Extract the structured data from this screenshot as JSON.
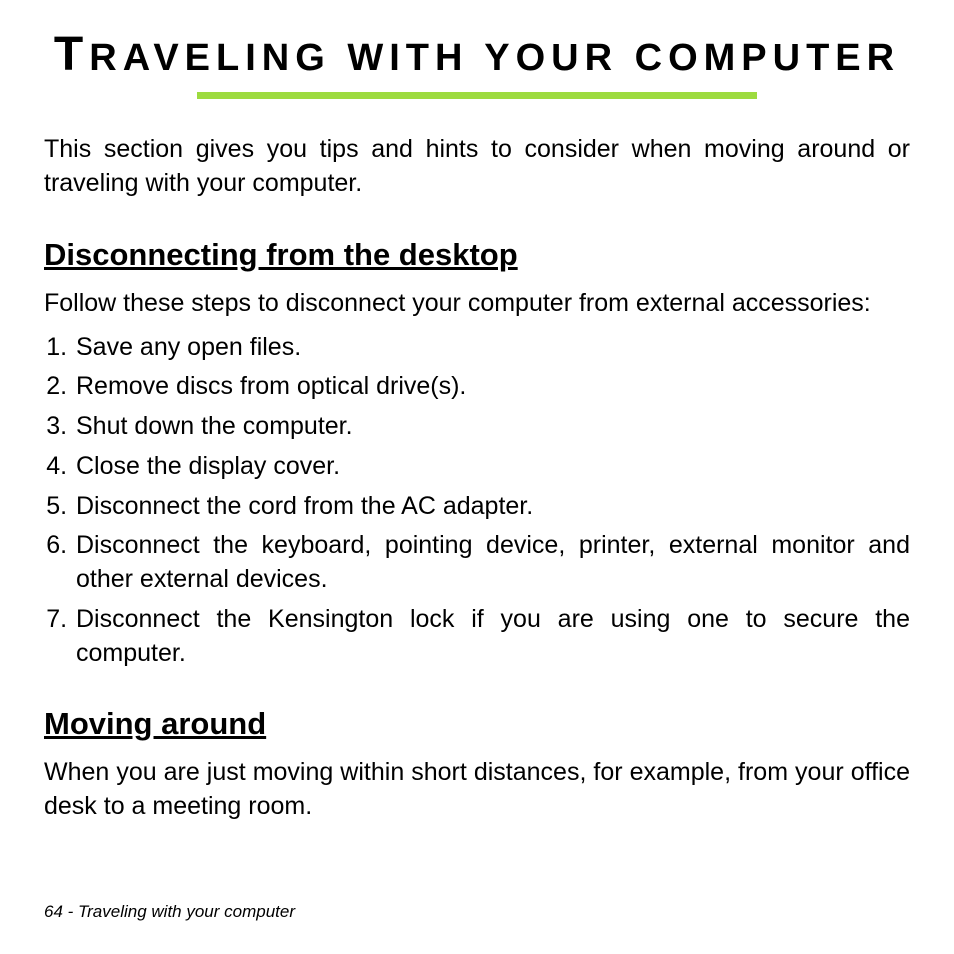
{
  "title_first": "T",
  "title_rest": "RAVELING WITH YOUR COMPUTER",
  "intro": "This section gives you tips and hints to consider when moving around or traveling with your computer.",
  "section1": {
    "heading": "Disconnecting from the desktop",
    "lead": "Follow these steps to disconnect your computer from external accessories:",
    "steps": [
      "Save any open files.",
      "Remove discs from optical drive(s).",
      "Shut down the computer.",
      "Close the display cover.",
      "Disconnect the cord from the AC adapter.",
      "Disconnect the keyboard, pointing device, printer, external monitor and other external devices.",
      "Disconnect the Kensington lock if you are using one to secure the computer."
    ]
  },
  "section2": {
    "heading": "Moving around",
    "lead": "When you are just moving within short distances, for example, from your office desk to a meeting room."
  },
  "footer": "64 - Traveling with your computer"
}
